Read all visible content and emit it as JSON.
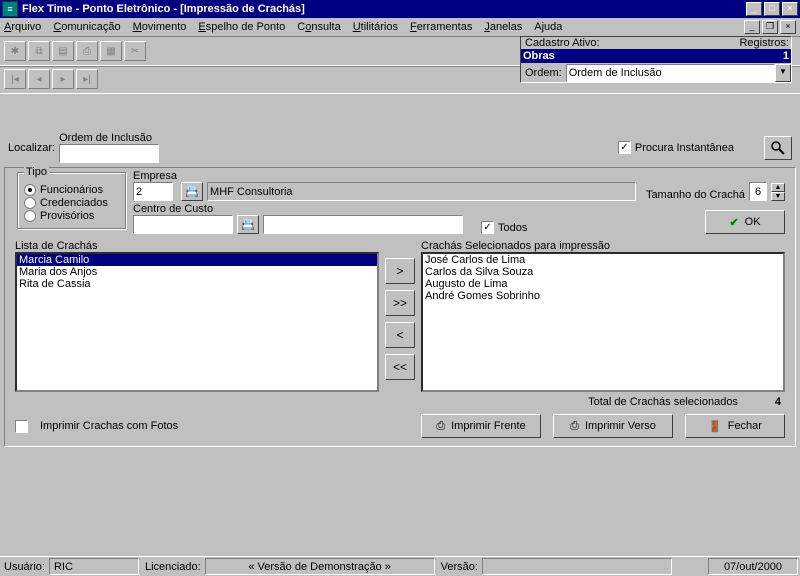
{
  "title": "Flex Time    -    Ponto Eletrônico - [Impressão de Crachás]",
  "menus": [
    "Arquivo",
    "Comunicação",
    "Movimento",
    "Espelho de Ponto",
    "Consulta",
    "Utilitários",
    "Ferramentas",
    "Janelas",
    "Ajuda"
  ],
  "info": {
    "cadastro_label": "Cadastro Ativo:",
    "cadastro_value": "Obras",
    "registros_label": "Registros:",
    "registros_value": "1",
    "ordem_label": "Ordem:",
    "ordem_value": "Ordem de Inclusão"
  },
  "localizar": {
    "label": "Localizar:",
    "field_label": "Ordem de Inclusão",
    "procura": "Procura Instantânea"
  },
  "tipo": {
    "caption": "Tipo",
    "options": [
      "Funcionários",
      "Credenciados",
      "Provisórios"
    ],
    "selected": 0
  },
  "empresa": {
    "label": "Empresa",
    "code": "2",
    "name": "MHF Consultoria"
  },
  "tamanho": {
    "label": "Tamanho do Crachá",
    "value": "6"
  },
  "centro": {
    "label": "Centro de Custo"
  },
  "todos": "Todos",
  "ok": "OK",
  "lists": {
    "left_label": "Lista de Crachás",
    "left_items": [
      "Marcia Camilo",
      "Maria dos Anjos",
      "Rita de Cassia"
    ],
    "left_selected": 0,
    "right_label": "Crachás Selecionados para impressão",
    "right_items": [
      "José Carlos de Lima",
      "Carlos da Silva Souza",
      "Augusto de Lima",
      "André Gomes Sobrinho"
    ]
  },
  "total": {
    "label": "Total de Crachás selecionados",
    "value": "4"
  },
  "check_fotos": "Imprimir Crachas com Fotos",
  "buttons": {
    "frente": "Imprimir Frente",
    "verso": "Imprimir Verso",
    "fechar": "Fechar"
  },
  "status": {
    "usuario_label": "Usuário:",
    "usuario": "RIC",
    "lic_label": "Licenciado:",
    "demo": "« Versão de Demonstração »",
    "versao_label": "Versão:",
    "data": "07/out/2000"
  }
}
